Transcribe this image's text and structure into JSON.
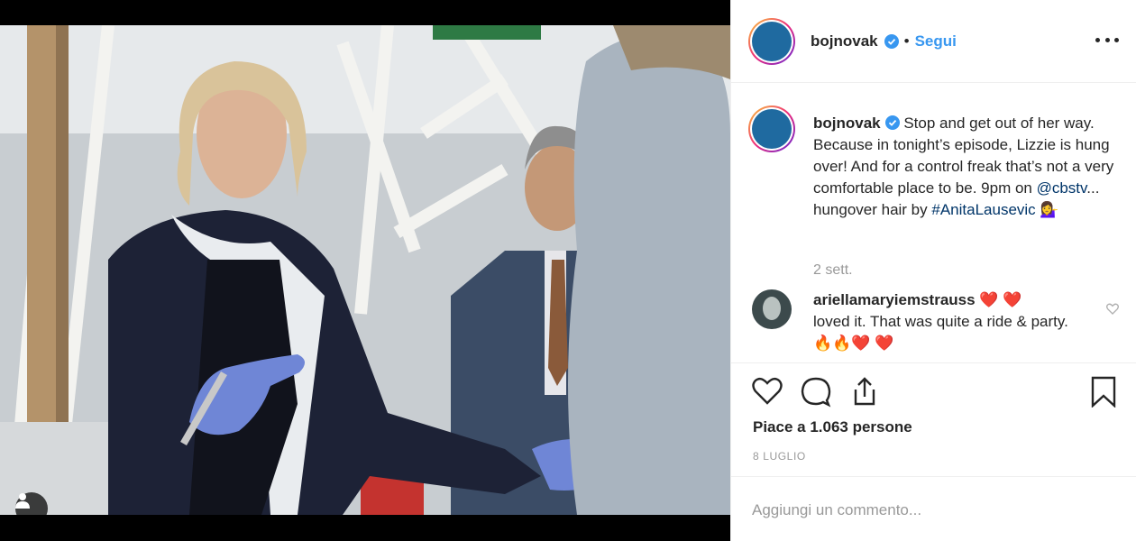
{
  "post": {
    "username": "bojnovak",
    "follow_label": "Segui",
    "dot": "•",
    "caption": {
      "username": "bojnovak",
      "text_before_link": " Stop and get out of her way. Because in tonight’s episode, Lizzie is hung over! And for a control freak that’s not a very comfortable place to be. 9pm on ",
      "mention": "@cbstv",
      "text_after_mention": "... hungover hair by ",
      "hashtag": "#AnitaLausevic",
      "emoji": "💁‍♀️",
      "time_ago": "2 sett."
    },
    "comments": [
      {
        "username": "ariellamaryiemstrauss",
        "username_emoji": "❤️ ❤️",
        "text": "loved it. That was quite a ride & party.🔥🔥❤️ ❤️"
      }
    ],
    "likes_text": "Piace a 1.063 persone",
    "date": "8 LUGLIO",
    "add_comment_placeholder": "Aggiungi un commento..."
  },
  "colors": {
    "link_blue": "#3897f0",
    "hashtag_blue": "#003569",
    "avatar_blue": "#1f6aa0",
    "muted_gray": "#999999"
  },
  "icons": {
    "verified": "verified-badge-icon",
    "more": "more-options-icon",
    "like": "heart-outline-icon",
    "comment": "speech-bubble-icon",
    "share": "share-icon",
    "save": "bookmark-icon",
    "tag": "user-tag-icon"
  }
}
